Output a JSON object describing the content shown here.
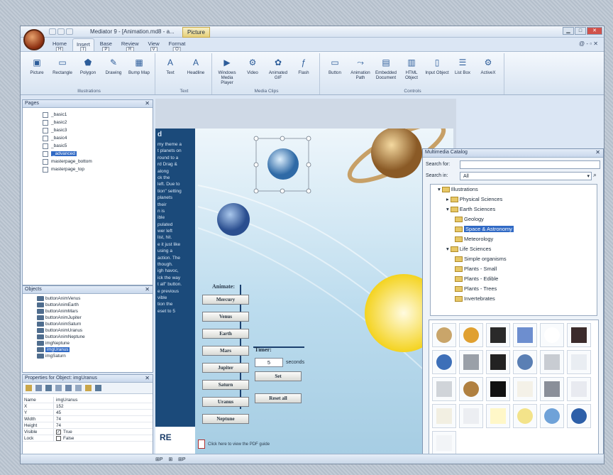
{
  "window": {
    "title": "Mediator 9 - [Animation.md8 - a...",
    "context_tab": "Picture",
    "controls": [
      "▁",
      "□",
      "✕"
    ]
  },
  "ribbon_tabs": [
    {
      "label": "Home",
      "key": "H"
    },
    {
      "label": "Insert",
      "key": "I"
    },
    {
      "label": "Base",
      "key": "P"
    },
    {
      "label": "Review",
      "key": "R"
    },
    {
      "label": "View",
      "key": "V"
    },
    {
      "label": "Format",
      "key": "O"
    }
  ],
  "ribbon_help": "@ - ▫ ✕",
  "ribbon_groups": [
    {
      "label": "Illustrations",
      "items": [
        {
          "label": "Picture",
          "icon": "picture-icon"
        },
        {
          "label": "Rectangle",
          "icon": "rectangle-icon"
        },
        {
          "label": "Polygon",
          "icon": "polygon-icon"
        },
        {
          "label": "Drawing",
          "icon": "pencil-icon"
        },
        {
          "label": "Bump Map",
          "icon": "bump-map-icon"
        }
      ]
    },
    {
      "label": "Text",
      "items": [
        {
          "label": "Text",
          "icon": "text-icon"
        },
        {
          "label": "Headline",
          "icon": "headline-icon"
        }
      ]
    },
    {
      "label": "Media Clips",
      "items": [
        {
          "label": "Windows Media Player",
          "icon": "media-player-icon"
        },
        {
          "label": "Video",
          "icon": "video-icon"
        },
        {
          "label": "Animated GIF",
          "icon": "animated-gif-icon"
        },
        {
          "label": "Flash",
          "icon": "flash-icon"
        }
      ]
    },
    {
      "label": "Controls",
      "items": [
        {
          "label": "Button",
          "icon": "button-icon"
        },
        {
          "label": "Animation Path",
          "icon": "animation-path-icon"
        },
        {
          "label": "Embedded Document",
          "icon": "embedded-document-icon"
        },
        {
          "label": "HTML Object",
          "icon": "html-object-icon"
        },
        {
          "label": "Input Object",
          "icon": "input-object-icon"
        },
        {
          "label": "List Box",
          "icon": "list-box-icon"
        },
        {
          "label": "ActiveX",
          "icon": "activex-icon"
        }
      ]
    }
  ],
  "pages_panel": {
    "title": "Pages",
    "items": [
      "_basic1",
      "_basic2",
      "_basic3",
      "_basic4",
      "_basic5",
      "_advanced",
      "masterpage_bottom",
      "masterpage_top"
    ],
    "selected": "_advanced"
  },
  "objects_panel": {
    "title": "Objects",
    "items": [
      "buttonAnimVenus",
      "buttonAnimEarth",
      "buttonAnimMars",
      "buttonAnimJupiter",
      "buttonAnimSaturn",
      "buttonAnimUranus",
      "buttonAnimNeptune",
      "imgNeptune",
      "imgUranus",
      "imgSaturn"
    ],
    "selected": "imgUranus"
  },
  "properties_panel": {
    "title": "Properties for Object: imgUranus",
    "rows": [
      {
        "key": "Name",
        "value": "imgUranus"
      },
      {
        "key": "X",
        "value": "152"
      },
      {
        "key": "Y",
        "value": "45"
      },
      {
        "key": "Width",
        "value": "74"
      },
      {
        "key": "Height",
        "value": "74"
      },
      {
        "key": "Visible",
        "value": "True"
      },
      {
        "key": "Lock",
        "value": "False"
      }
    ]
  },
  "slide": {
    "left_text": [
      "d",
      "my theme a",
      "t planets on",
      "round to a",
      "rd Drag &",
      "along",
      "ck the",
      "left. Due to",
      "tion\" setting",
      "planets",
      "their",
      "n is",
      "ible",
      "pulated",
      "wer left",
      "list, hit.",
      "e it just like",
      "using a",
      "action. The",
      "though.",
      "igh havoc,",
      "ick the way",
      "t all\" button.",
      "e previous",
      "vible",
      "tion the",
      "eset to 5"
    ],
    "animate_label": "Animate:",
    "planet_buttons": [
      "Mercury",
      "Venus",
      "Earth",
      "Mars",
      "Jupiter",
      "Saturn",
      "Uranus",
      "Neptune"
    ],
    "timer_label": "Timer:",
    "timer_value": "5",
    "timer_unit": "seconds",
    "set_button": "Set",
    "reset_button": "Reset all",
    "logo_text": "RE",
    "pdf_link": "Click here to view the PDF guide"
  },
  "catalog": {
    "title": "Multimedia Catalog",
    "search_for_label": "Search for:",
    "search_in_label": "Search in:",
    "search_in_value": "All",
    "tree": [
      {
        "label": "Illustrations",
        "level": 0,
        "expanded": true
      },
      {
        "label": "Physical Sciences",
        "level": 1,
        "expanded": false
      },
      {
        "label": "Earth Sciences",
        "level": 1,
        "expanded": true
      },
      {
        "label": "Geology",
        "level": 2
      },
      {
        "label": "Space & Astronomy",
        "level": 2,
        "selected": true
      },
      {
        "label": "Meteorology",
        "level": 2
      },
      {
        "label": "Life Sciences",
        "level": 1,
        "expanded": true
      },
      {
        "label": "Simple organisms",
        "level": 2
      },
      {
        "label": "Plants - Small",
        "level": 2
      },
      {
        "label": "Plants - Edible",
        "level": 2
      },
      {
        "label": "Plants - Trees",
        "level": 2
      },
      {
        "label": "Invertebrates",
        "level": 2
      }
    ],
    "thumbnails": [
      "moon-thumb",
      "sun-half-thumb",
      "galaxy-thumb",
      "spiral-galaxy-thumb",
      "crescent-thumb",
      "nebula-thumb",
      "blue-planet-thumb",
      "observatory-thumb",
      "starfield-thumb",
      "neptune-thumb",
      "satellite-dish-thumb",
      "rocket-thumb",
      "satellite-thumb",
      "saturn-thumb",
      "space-station-thumb",
      "star-thumb",
      "iss-thumb",
      "telescope-thumb",
      "rocket-launch-thumb",
      "antenna-thumb",
      "yellow-star-thumb",
      "yellow-moon-thumb",
      "uranus-thumb",
      "earth-thumb",
      "constellation-thumb"
    ]
  },
  "statusbar": [
    "⊞P",
    "⊞",
    "⊞P"
  ]
}
